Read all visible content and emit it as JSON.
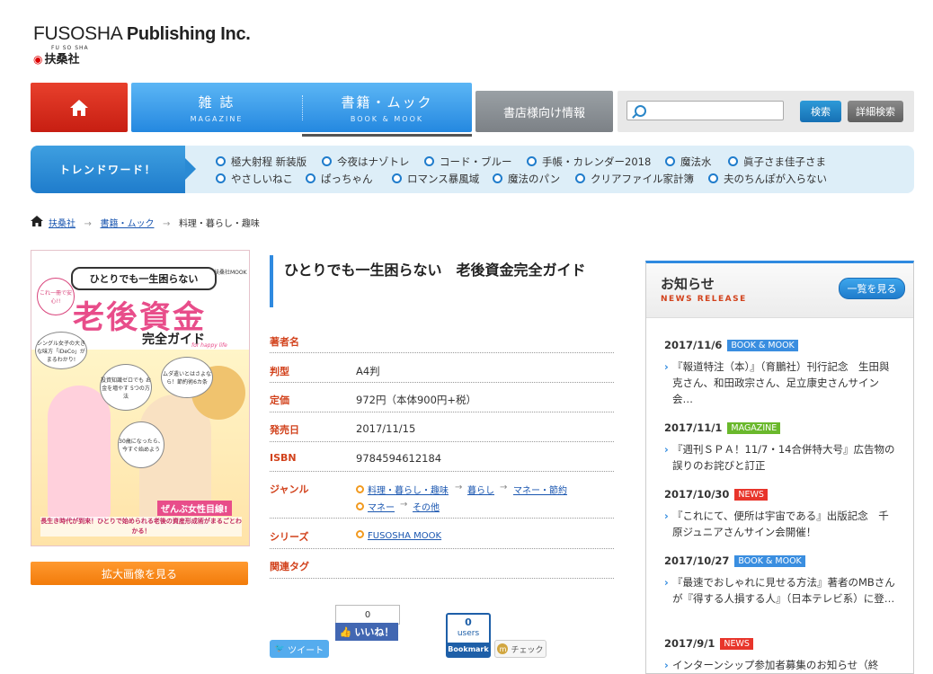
{
  "header": {
    "logo_en_light": "FUSOSHA",
    "logo_en_bold": "Publishing Inc.",
    "logo_ruby": "FU  SO  SHA",
    "logo_jp": "扶桑社",
    "logo_mark": "◉"
  },
  "nav": {
    "home_icon": "home-icon",
    "magazine_jp": "雑 誌",
    "magazine_en": "MAGAZINE",
    "book_jp": "書籍・ムック",
    "book_en": "BOOK & MOOK",
    "store_info": "書店様向け情報",
    "search_placeholder": "",
    "search_button": "検索",
    "advanced_search": "詳細検索"
  },
  "trend": {
    "label": "トレンドワード！",
    "row1": [
      "極大射程 新装版",
      "今夜はナゾトレ",
      "コード・ブルー",
      "手帳・カレンダー2018",
      "魔法水",
      "眞子さま佳子さま"
    ],
    "row2": [
      "やさしいねこ",
      "ぱっちゃん",
      "ロマンス暴風域",
      "魔法のパン",
      "クリアファイル家計簿",
      "夫のちんぽが入らない"
    ]
  },
  "breadcrumb": {
    "home": "扶桑社",
    "books": "書籍・ムック",
    "current": "料理・暮らし・趣味"
  },
  "cover": {
    "title_line": "ひとりでも一生困らない",
    "mook": "扶桑社MOOK",
    "main": "老後資金",
    "sub": "完全ガイド",
    "for": "for happy life",
    "badge": "これ一冊で安心!!",
    "bubble1": "シングル女子の大きな味方「iDeCo」がまるわかり!",
    "bubble2": "投資知識ゼロでも お金を増やす 5つの方法",
    "bubble3": "ムダ遣いとはさよなら！節約術6カ条",
    "bubble4": "30歳になったら、今すぐ始めよう",
    "red": "ぜんぶ女性目線!",
    "bottom": "長生き時代が到来！ひとりで始められる老後の資産形成術がまるごとわかる！"
  },
  "zoom_button": "拡大画像を見る",
  "book": {
    "title": "ひとりでも一生困らない　老後資金完全ガイド",
    "labels": {
      "author": "著者名",
      "format": "判型",
      "price": "定価",
      "date": "発売日",
      "isbn": "ISBN",
      "genre": "ジャンル",
      "series": "シリーズ",
      "tags": "関連タグ"
    },
    "format": "A4判",
    "price": "972円（本体900円+税）",
    "date": "2017/11/15",
    "isbn": "9784594612184",
    "genre": [
      "料理・暮らし・趣味",
      "暮らし",
      "マネー・節約",
      "マネー",
      "その他"
    ],
    "series": "FUSOSHA MOOK"
  },
  "social": {
    "tweet": "ツイート",
    "fb_count": "0",
    "fb_like": "いいね！",
    "hb_count": "0",
    "hb_users": "users",
    "hb_label": "Bookmark",
    "mixi": "チェック"
  },
  "news": {
    "title": "お知らせ",
    "subtitle": "NEWS RELEASE",
    "list_button": "一覧を見る",
    "items": [
      {
        "date": "2017/11/6",
        "tag": "BOOK & MOOK",
        "text": "『報道特注（本）』（育鵬社）刊行記念　生田與克さん、和田政宗さん、足立康史さんサイン会…"
      },
      {
        "date": "2017/11/1",
        "tag": "MAGAZINE",
        "text": "『週刊ＳＰＡ！11/7・14合併特大号』広告物の誤りのお詫びと訂正"
      },
      {
        "date": "2017/10/30",
        "tag": "NEWS",
        "text": "『これにて、便所は宇宙である』出版記念　千原ジュニアさんサイン会開催！"
      },
      {
        "date": "2017/10/27",
        "tag": "BOOK & MOOK",
        "text": "『最速でおしゃれに見せる方法』著者のMBさんが『得する人損する人』（日本テレビ系）に登…"
      },
      {
        "date": "2017/9/1",
        "tag": "NEWS",
        "text": "インターンシップ参加者募集のお知らせ（終"
      }
    ],
    "tag_colors": {
      "BOOK & MOOK": "#3a8ee0",
      "MAGAZINE": "#6ab82c",
      "NEWS": "#e8352b"
    }
  }
}
